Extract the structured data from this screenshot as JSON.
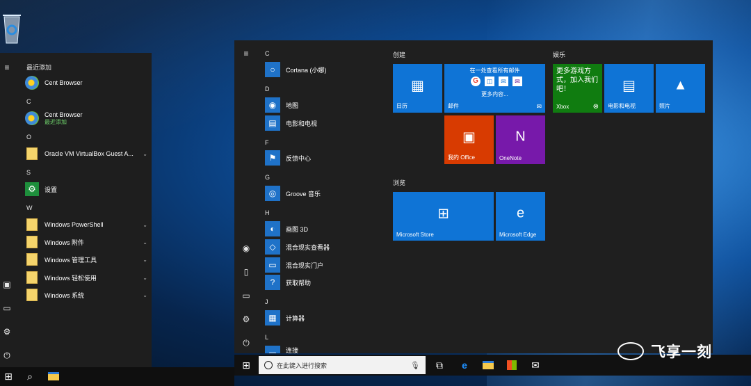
{
  "left_menu": {
    "recent_header": "最近添加",
    "recent_app": "Cent Browser",
    "letters": {
      "c": "C",
      "o": "O",
      "s": "S",
      "w": "W"
    },
    "c_app": "Cent Browser",
    "c_app_sub": "最近添加",
    "o_app": "Oracle VM VirtualBox Guest A...",
    "s_app": "设置",
    "w_apps": [
      "Windows PowerShell",
      "Windows 附件",
      "Windows 管理工具",
      "Windows 轻松使用",
      "Windows 系统"
    ]
  },
  "right_menu": {
    "letters": {
      "c": "C",
      "d": "D",
      "f": "F",
      "g": "G",
      "h": "H",
      "j": "J",
      "l": "L"
    },
    "apps": {
      "cortana": "Cortana (小娜)",
      "maps": "地图",
      "movies": "电影和电视",
      "feedback": "反馈中心",
      "groove": "Groove 音乐",
      "paint3d": "画图 3D",
      "mr_viewer": "混合现实查看器",
      "mr_portal": "混合现实门户",
      "get_help": "获取帮助",
      "calculator": "计算器",
      "l_partial": "连接"
    },
    "groups": {
      "create": "创建",
      "entertainment": "娱乐",
      "browse": "浏览"
    },
    "tiles": {
      "calendar": "日历",
      "mail_top": "在一处查看所有邮件",
      "mail_more": "更多内容...",
      "mail": "邮件",
      "office": "我的 Office",
      "onenote": "OneNote",
      "xbox_text": "更多游戏方式，加入我们吧！",
      "xbox": "Xbox",
      "movies_tile": "电影和电视",
      "photos": "照片",
      "store": "Microsoft Store",
      "edge": "Microsoft Edge"
    }
  },
  "taskbar": {
    "search_placeholder": "在此键入进行搜索"
  },
  "watermark": "飞享一刻",
  "colors": {
    "tile_blue": "#0f74d6",
    "xbox_green": "#107c10",
    "office_red": "#d83b01",
    "onenote_purple": "#7719aa"
  }
}
